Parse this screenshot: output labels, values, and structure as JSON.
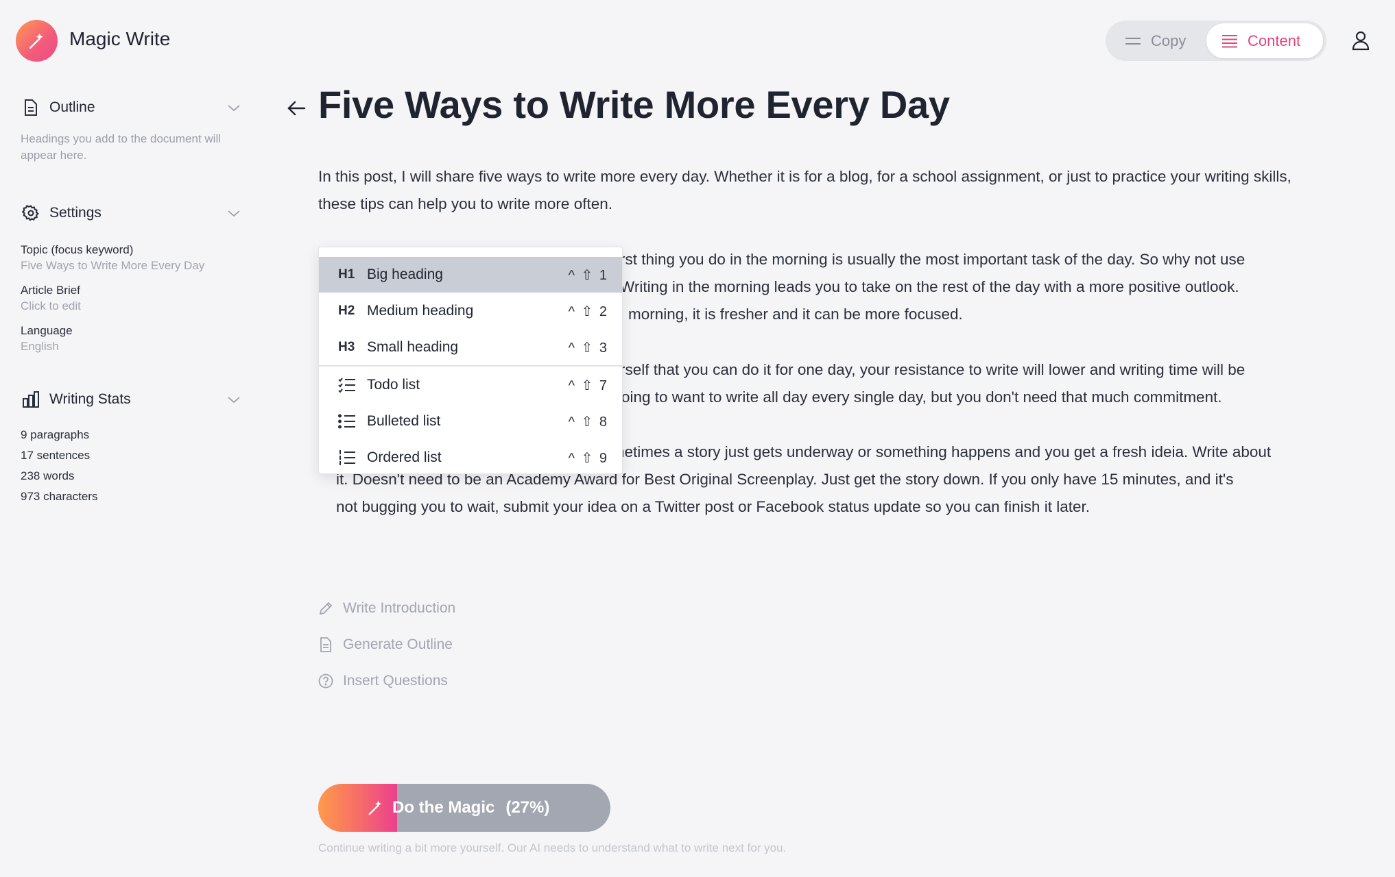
{
  "header": {
    "app_title": "Magic Write",
    "logo_icon": "magic-wand-icon",
    "toggle": {
      "copy_label": "Copy",
      "content_label": "Content",
      "selected": "Content"
    },
    "accent_color": "#e2447f"
  },
  "sidebar": {
    "outline": {
      "label": "Outline",
      "description": "Headings you add to the document will appear here."
    },
    "settings": {
      "label": "Settings",
      "fields": [
        {
          "label": "Topic (focus keyword)",
          "value": "Five Ways to Write More Every Day"
        },
        {
          "label": "Article Brief",
          "value": "Click to edit"
        },
        {
          "label": "Language",
          "value": "English"
        }
      ]
    },
    "writing_stats": {
      "label": "Writing Stats",
      "stats": [
        "9 paragraphs",
        "17 sentences",
        "238 words",
        "973 characters"
      ]
    }
  },
  "document": {
    "title": "Five Ways to Write More Every Day",
    "p1": "In this post, I will share five ways to write more every day. Whether it is for a blog, for a school assignment, or just to practice your writing skills, these tips can help you to write more often.",
    "p2_lines": [
      "rst thing you do in the morning is usually the most important task of the day. So why not use",
      "Writing in the morning leads you to take on the rest of the day with a more positive outlook.",
      "morning, it is fresher and it can be more focused."
    ],
    "p3_lines": [
      "rself that you can do it for one day, your resistance to write will lower and writing time will be",
      "oing to want to write all day every single day, but you don't need that much commitment."
    ],
    "p4_lines": [
      "netimes a story just gets underway or something happens and you get a fresh ideia. Write about",
      "it. Doesn't need to be an Academy Award for Best Original Screenplay. Just get the story down. If you only have 15 minutes, and it's",
      "not bugging you to wait, submit your idea on a Twitter post or Facebook status update so you can finish it later."
    ]
  },
  "menu": {
    "items": [
      {
        "code": "H1",
        "label": "Big heading",
        "shortcut": "^ ⇧ 1"
      },
      {
        "code": "H2",
        "label": "Medium heading",
        "shortcut": "^ ⇧ 2"
      },
      {
        "code": "H3",
        "label": "Small heading",
        "shortcut": "^ ⇧ 3"
      },
      {
        "icon": "todo-list-icon",
        "label": "Todo list",
        "shortcut": "^ ⇧ 7"
      },
      {
        "icon": "bulleted-list-icon",
        "label": "Bulleted list",
        "shortcut": "^ ⇧ 8"
      },
      {
        "icon": "ordered-list-icon",
        "label": "Ordered list",
        "shortcut": "^ ⇧ 9"
      }
    ],
    "selected": "Big heading"
  },
  "actions": [
    {
      "icon": "pencil-icon",
      "label": "Write Introduction"
    },
    {
      "icon": "document-icon",
      "label": "Generate Outline"
    },
    {
      "icon": "question-circle-icon",
      "label": "Insert Questions"
    }
  ],
  "magic_button": {
    "label": "Do the Magic",
    "progress_label": "(27%)",
    "progress": 0.27,
    "hint": "Continue writing a bit more yourself. Our AI needs to understand what to write next for you."
  }
}
